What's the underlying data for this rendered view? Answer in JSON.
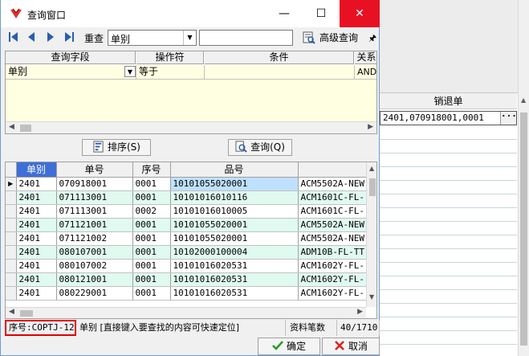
{
  "window": {
    "title": "查询窗口",
    "min_glyph": "—",
    "max_glyph": "☐",
    "close_glyph": "✕"
  },
  "toolbar": {
    "requery_label": "重查",
    "field_select_value": "单别",
    "search_value": "",
    "advanced_label": "高级查询"
  },
  "query_grid": {
    "headers": [
      "查询字段",
      "操作符",
      "条件",
      "关系"
    ],
    "row": {
      "field": "单别",
      "operator": "等于",
      "condition": "",
      "relation": "AND"
    }
  },
  "buttons": {
    "sort_label": "排序(S)",
    "query_label": "查询(Q)",
    "ok_label": "确定",
    "cancel_label": "取消"
  },
  "result_grid": {
    "headers": [
      "单别",
      "单号",
      "序号",
      "品号",
      ""
    ],
    "rows": [
      [
        "2401",
        "070918001",
        "0001",
        "10101055020001",
        "ACM5502A-NEW"
      ],
      [
        "2401",
        "071113001",
        "0001",
        "10101016010116",
        "ACM1601C-FL-"
      ],
      [
        "2401",
        "071113001",
        "0002",
        "10101016010005",
        "ACM1601C-FL-"
      ],
      [
        "2401",
        "071121001",
        "0001",
        "10101055020001",
        "ACM5502A-NEW"
      ],
      [
        "2401",
        "071121002",
        "0001",
        "10101055020001",
        "ACM5502A-NEW"
      ],
      [
        "2401",
        "080107001",
        "0001",
        "10102000100004",
        "ADM10B-FL-TT"
      ],
      [
        "2401",
        "080107002",
        "0001",
        "10101016020531",
        "ACM1602Y-FL-"
      ],
      [
        "2401",
        "080121001",
        "0001",
        "10101016020531",
        "ACM1602Y-FL-"
      ],
      [
        "2401",
        "080229001",
        "0001",
        "10101016020531",
        "ACM1602Y-FL-"
      ]
    ]
  },
  "status": {
    "seq_text": "序号:COPTJ-12",
    "hint_text": "单别 [直接键入要查找的内容可快速定位]",
    "count_label": "资料笔数",
    "count_value": "40/1710"
  },
  "background_grid": {
    "header": "销退单",
    "cell_value": "2401,070918001,0001",
    "ellipsis": "···"
  },
  "colors": {
    "accent": "#3e6fd6",
    "query_row_bg": "#ffffe1",
    "alt_row_bg": "#e0faf0",
    "close_red": "#e81123",
    "highlight_border": "#e00000"
  }
}
